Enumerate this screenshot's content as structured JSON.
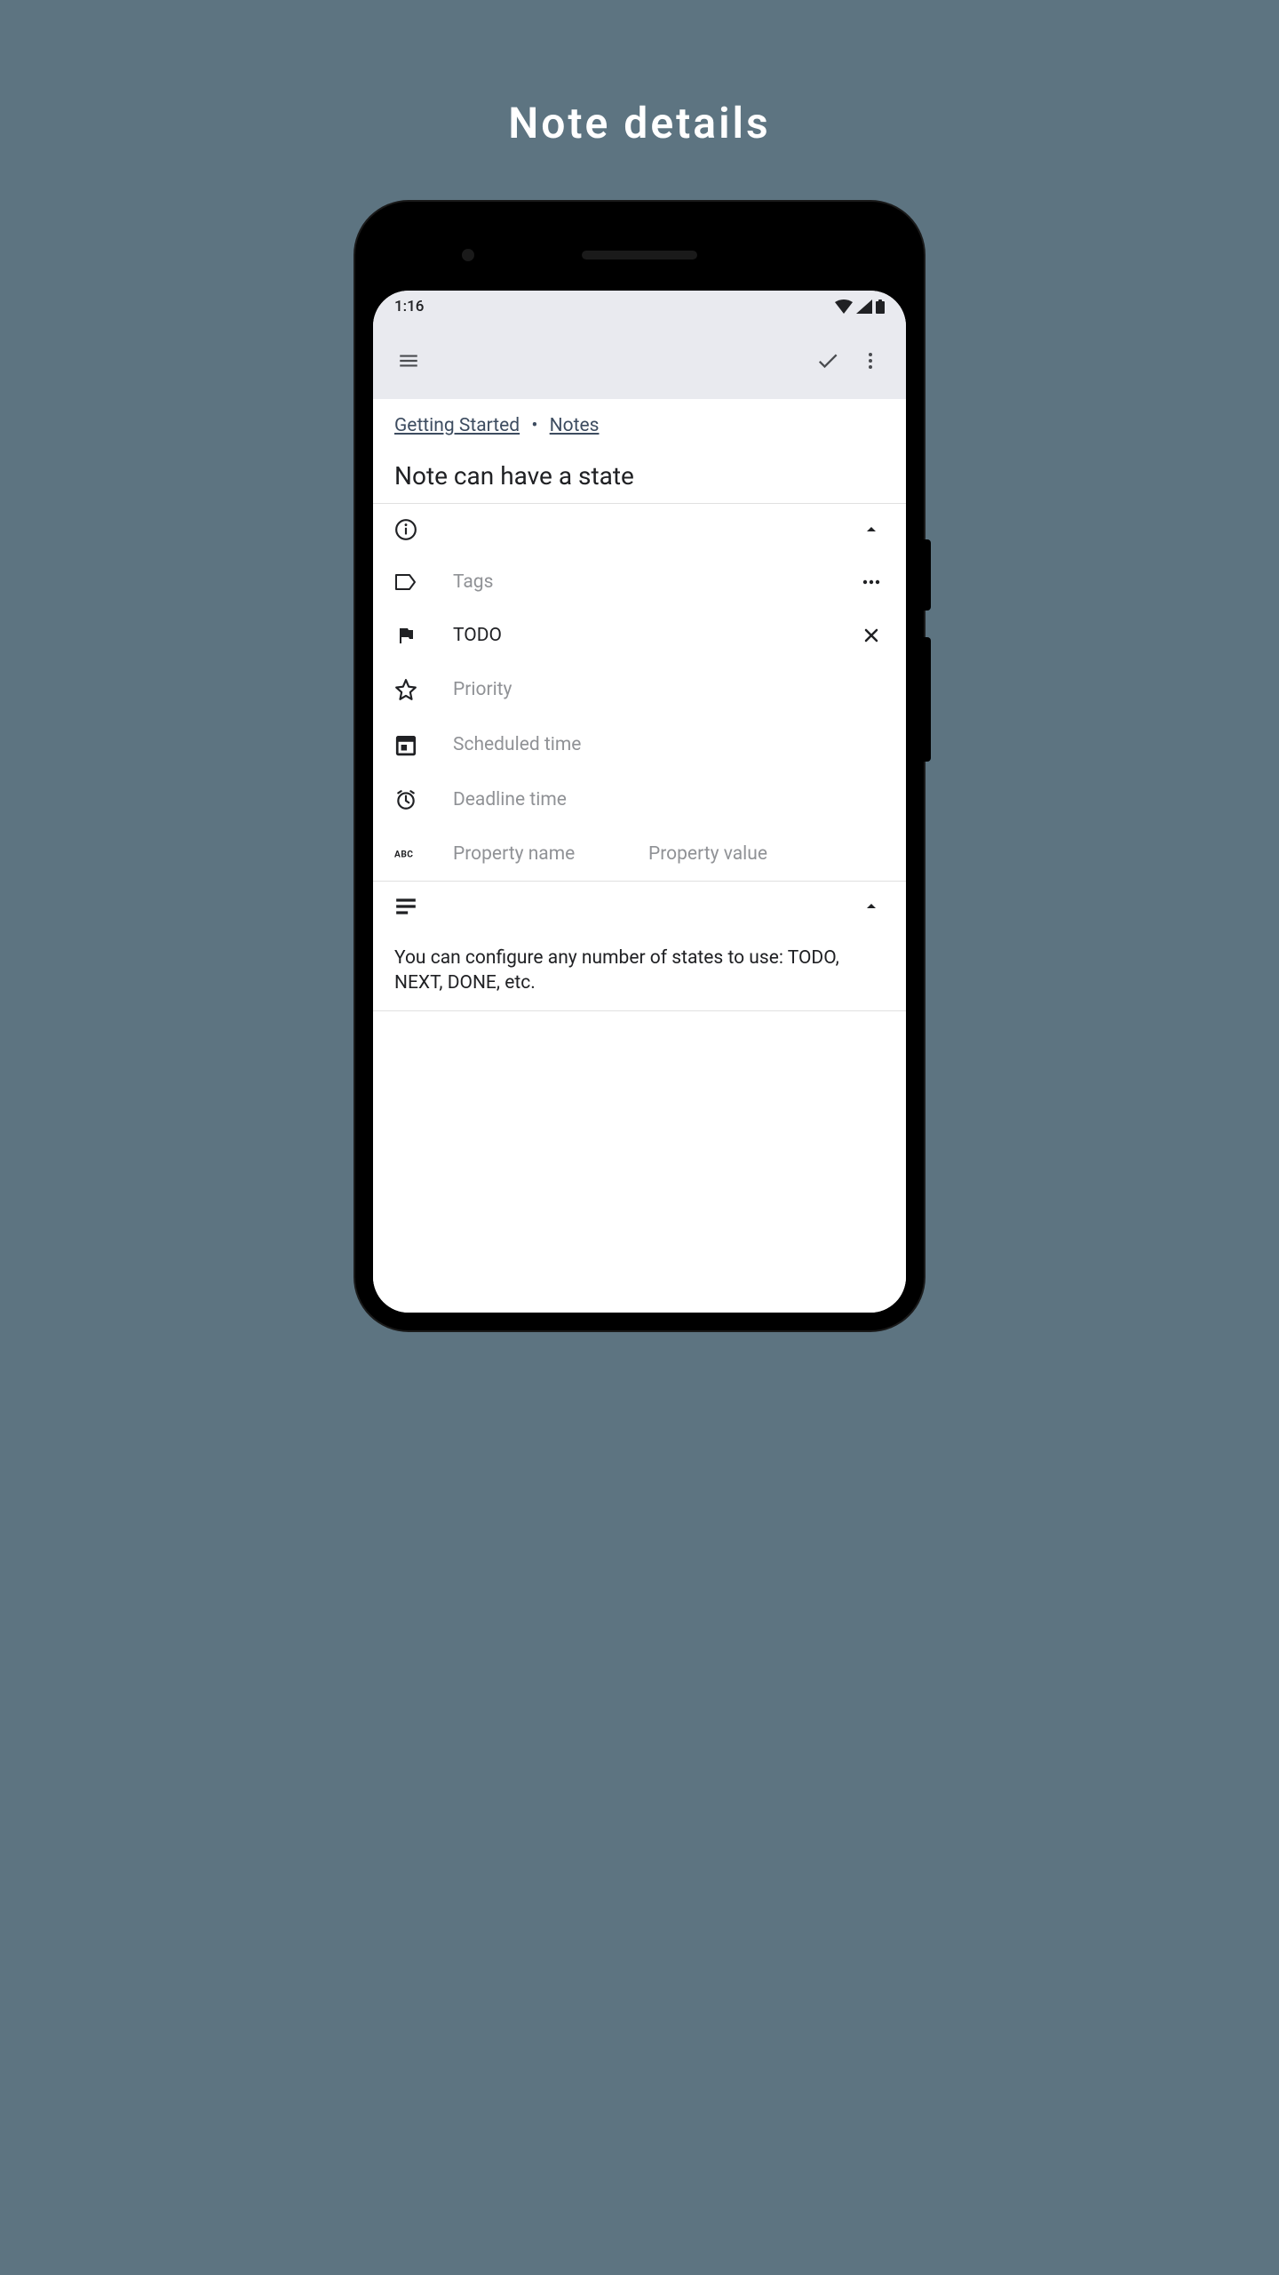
{
  "page": {
    "title": "Note details"
  },
  "status_bar": {
    "time": "1:16"
  },
  "breadcrumb": {
    "first": "Getting Started",
    "sep": "•",
    "second": "Notes"
  },
  "note": {
    "title": "Note can have a state",
    "tags_placeholder": "Tags",
    "state": "TODO",
    "priority_placeholder": "Priority",
    "scheduled_placeholder": "Scheduled time",
    "deadline_placeholder": "Deadline time",
    "property_name_placeholder": "Property name",
    "property_value_placeholder": "Property value",
    "body": "You can configure any number of states to use: TODO, NEXT, DONE, etc."
  }
}
